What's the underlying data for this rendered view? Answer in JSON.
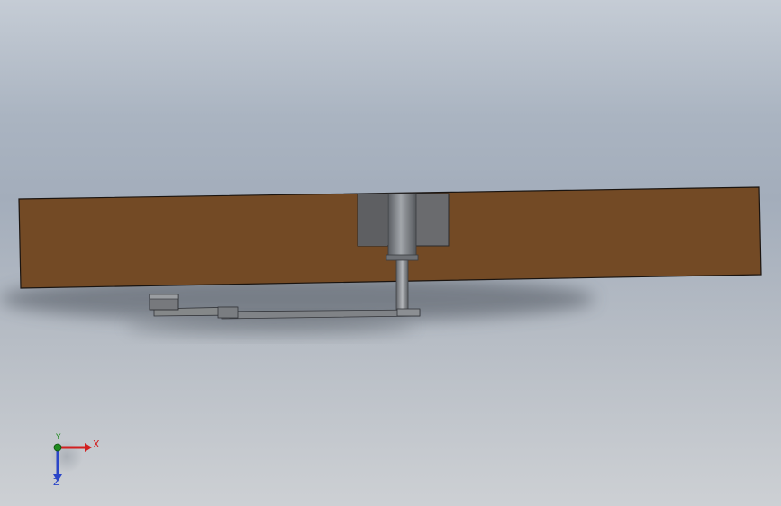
{
  "viewport": {
    "background_top": "#c5ccd5",
    "background_bottom": "#cdd0d4"
  },
  "colors": {
    "wood_board": "#734a25",
    "pocket": "#6a6b6e",
    "steel": "#7c7f84",
    "axis_x": "#d22020",
    "axis_y": "#1e8a1e",
    "axis_z": "#2a45c8"
  },
  "triad": {
    "x_label": "X",
    "y_label": "Y",
    "z_label": "Z"
  }
}
